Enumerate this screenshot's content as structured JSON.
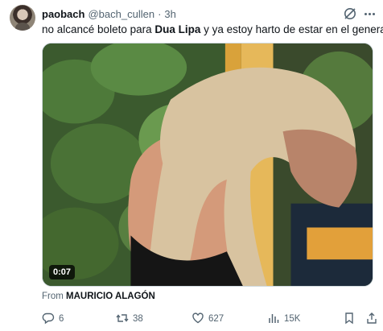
{
  "tweet": {
    "display_name": "paobach",
    "handle": "@bach_cullen",
    "separator": "·",
    "time": "3h",
    "text_before": "no alcancé boleto para ",
    "text_bold": "Dua Lipa",
    "text_after": " y ya estoy harto de estar en el general b",
    "video_duration": "0:07",
    "source_prefix": "From",
    "source_name": "MAURICIO ALAGÓN"
  },
  "actions": {
    "replies": "6",
    "reposts": "38",
    "likes": "627",
    "views": "15K"
  },
  "icons": {
    "grok": "grok-icon",
    "more": "more-icon",
    "reply": "reply-icon",
    "repost": "repost-icon",
    "like": "heart-icon",
    "views": "views-icon",
    "bookmark": "bookmark-icon",
    "share": "share-icon"
  },
  "colors": {
    "text": "#0f1419",
    "secondary": "#536471",
    "border": "#cfd9de"
  }
}
